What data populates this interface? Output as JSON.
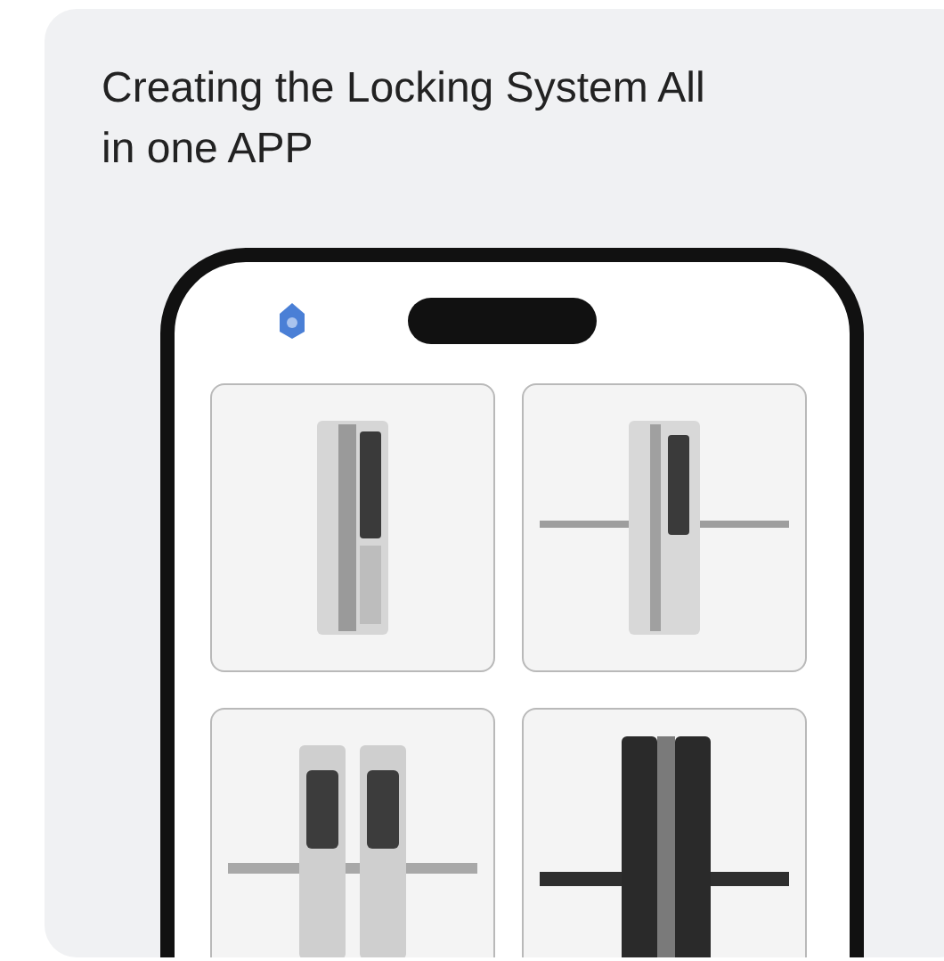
{
  "card": {
    "title": "Creating the Locking System All in one APP"
  },
  "phone_screen": {
    "products": [
      {
        "kind": "slim"
      },
      {
        "kind": "lever"
      },
      {
        "kind": "double"
      },
      {
        "kind": "dark"
      }
    ]
  }
}
